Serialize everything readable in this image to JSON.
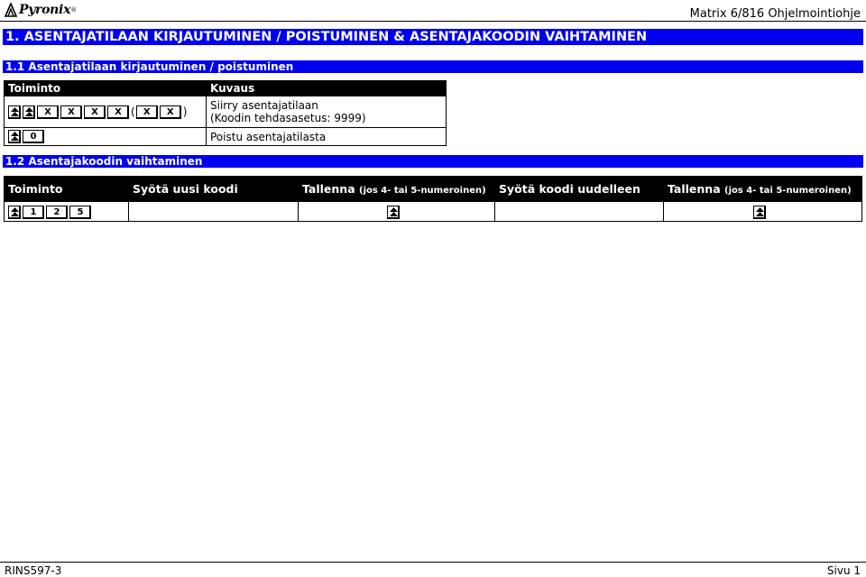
{
  "header": {
    "logo_text": "Pyronix",
    "logo_tm": "®",
    "doc_title": "Matrix 6/816 Ohjelmointiohje"
  },
  "section": {
    "title": "1. ASENTAJATILAAN KIRJAUTUMINEN / POISTUMINEN & ASENTAJAKOODIN VAIHTAMINEN"
  },
  "sub1": {
    "title": "1.1 Asentajatilaan kirjautuminen / poistuminen",
    "headers": {
      "action": "Toiminto",
      "description": "Kuvaus"
    },
    "row1": {
      "keys": [
        "X",
        "X",
        "X",
        "X",
        "X",
        "X"
      ],
      "paren_open": "(",
      "paren_close": ")",
      "desc_line1": "Siirry asentajatilaan",
      "desc_line2": "(Koodin tehdasasetus: 9999)"
    },
    "row2": {
      "key": "0",
      "desc": "Poistu asentajatilasta"
    }
  },
  "sub2": {
    "title": "1.2 Asentajakoodin vaihtaminen",
    "headers": {
      "action": "Toiminto",
      "enter_new": "Syötä uusi koodi",
      "save1": "Tallenna",
      "save1_note": "(jos 4- tai 5-numeroinen)",
      "enter_again": "Syötä koodi uudelleen",
      "save2": "Tallenna",
      "save2_note": "(jos 4- tai 5-numeroinen)"
    },
    "row": {
      "keys": [
        "1",
        "2",
        "5"
      ]
    }
  },
  "icons": {
    "arrow_key": "double-up-arrow-icon"
  },
  "footer": {
    "left": "RINS597-3",
    "right": "Sivu 1"
  }
}
